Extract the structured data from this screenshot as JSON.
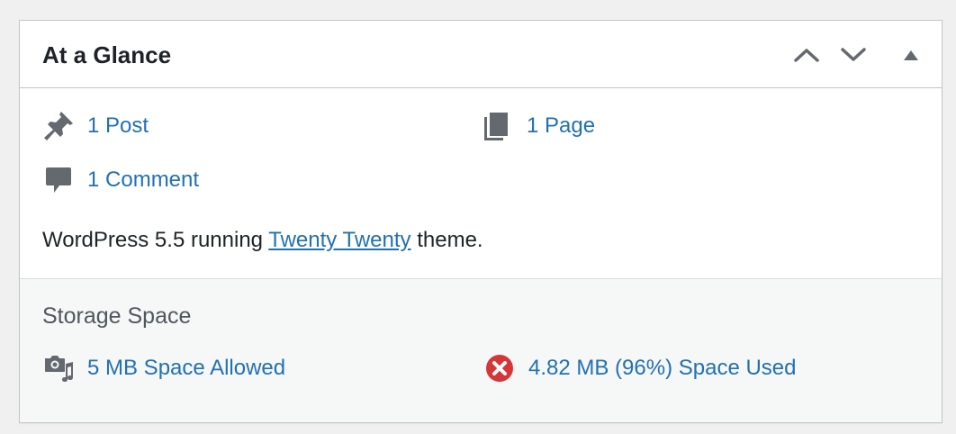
{
  "widget": {
    "title": "At a Glance",
    "controls": {
      "move_up_icon": "chevron-up-icon",
      "move_down_icon": "chevron-down-icon",
      "toggle_icon": "triangle-up-icon"
    }
  },
  "glance": {
    "posts": {
      "label": "1 Post",
      "icon": "pushpin-icon"
    },
    "pages": {
      "label": "1 Page",
      "icon": "pages-icon"
    },
    "comments": {
      "label": "1 Comment",
      "icon": "comment-icon"
    }
  },
  "version": {
    "prefix": "WordPress 5.5 running",
    "theme_link": "Twenty Twenty",
    "suffix": "theme."
  },
  "storage": {
    "heading": "Storage Space",
    "allowed": {
      "label": "5 MB Space Allowed",
      "icon": "media-icon"
    },
    "used": {
      "label": "4.82 MB (96%) Space Used",
      "icon": "error-circle-icon",
      "status_color": "#d63638"
    }
  },
  "colors": {
    "link": "#2271b1",
    "text": "#1d2327",
    "icon_gray": "#646970",
    "panel_bg": "#f6f7f7",
    "page_bg": "#f0f0f1"
  }
}
